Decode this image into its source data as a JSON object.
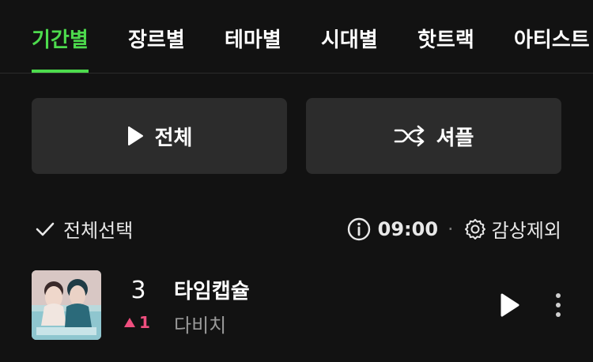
{
  "tabs": [
    {
      "label": "기간별",
      "active": true
    },
    {
      "label": "장르별",
      "active": false
    },
    {
      "label": "테마별",
      "active": false
    },
    {
      "label": "시대별",
      "active": false
    },
    {
      "label": "핫트랙",
      "active": false
    },
    {
      "label": "아티스트",
      "active": false
    }
  ],
  "actions": {
    "play_all_label": "전체",
    "shuffle_label": "셔플"
  },
  "list_header": {
    "select_all_label": "전체선택",
    "duration": "09:00",
    "exclude_label": "감상제외"
  },
  "tracks": [
    {
      "rank": "3",
      "rank_change": "1",
      "rank_change_direction": "up",
      "title": "타임캡슐",
      "artist": "다비치"
    }
  ],
  "colors": {
    "accent": "#4ddb4d",
    "rank_up": "#ef4f7f",
    "button_bg": "#2c2c2c",
    "background": "#121212"
  },
  "icons": [
    "play-icon",
    "shuffle-icon",
    "check-icon",
    "info-icon",
    "gear-icon",
    "more-vertical-icon",
    "triangle-up-icon"
  ]
}
